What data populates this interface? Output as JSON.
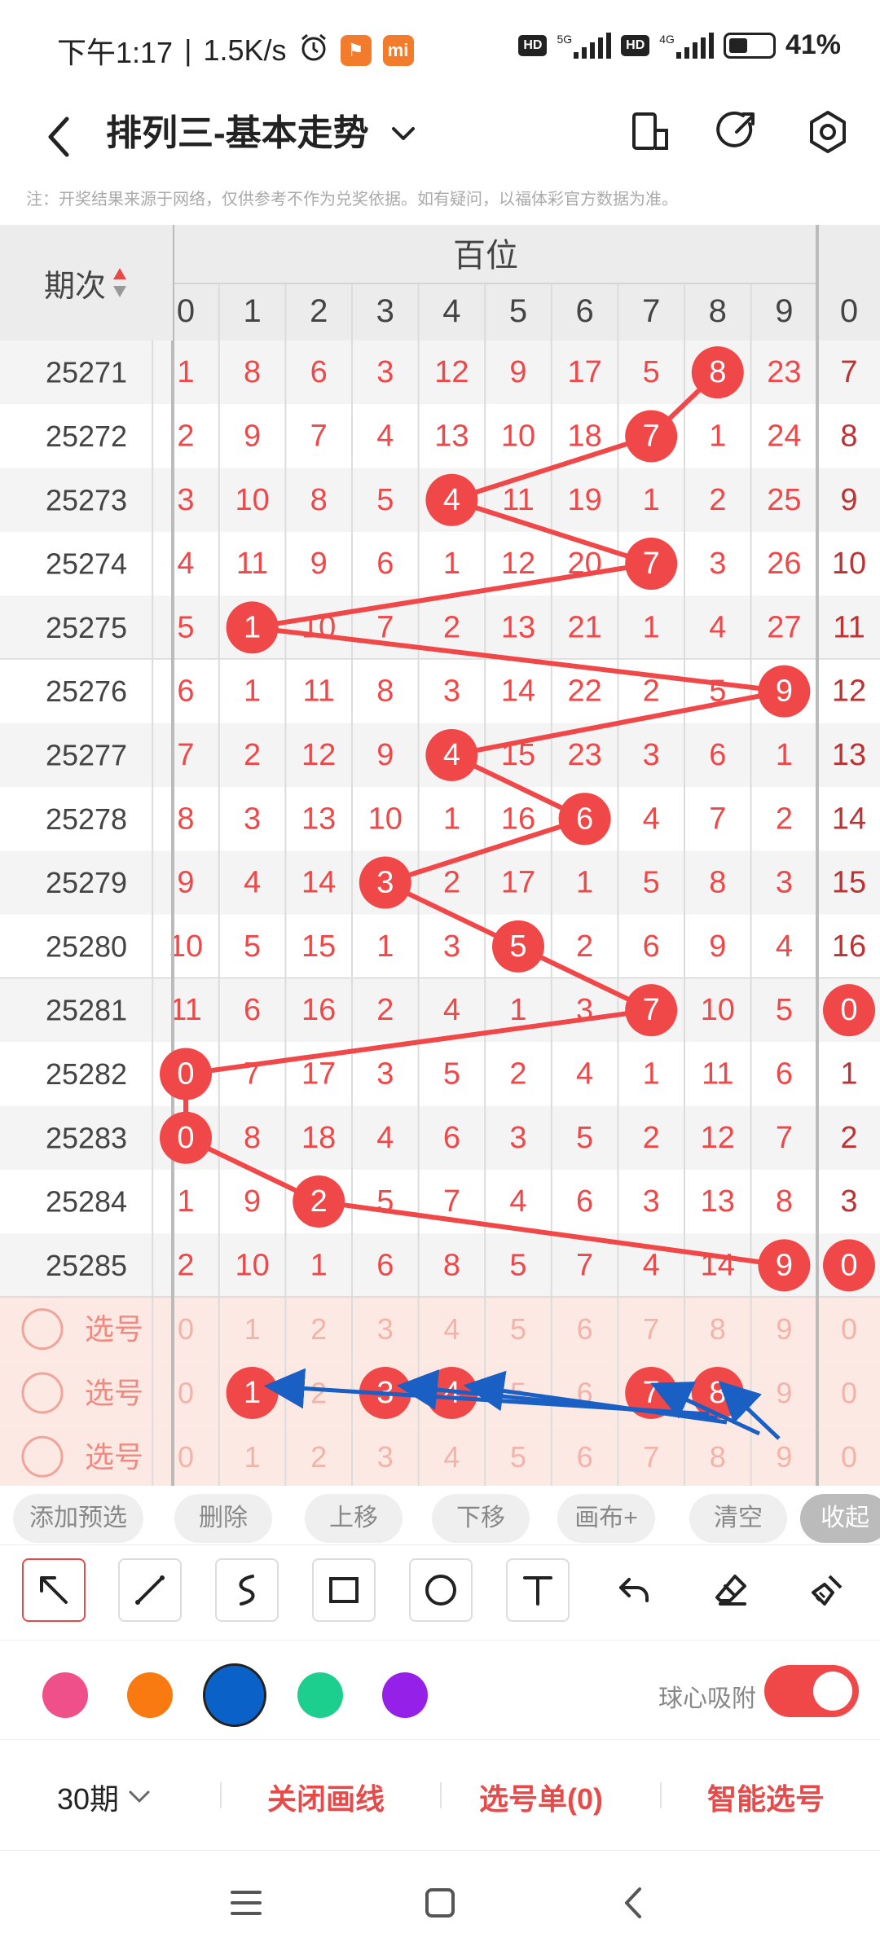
{
  "status_bar": {
    "time": "下午1:17",
    "speed": "1.5K/s",
    "app_badge": "mi",
    "hd": "HD",
    "net_5g": "5G",
    "net_4g": "4G",
    "battery": "41%"
  },
  "header": {
    "title": "排列三-基本走势"
  },
  "note": "注：开奖结果来源于网络，仅供参考不作为兑奖依据。如有疑问，以福体彩官方数据为准。",
  "table": {
    "period_header": "期次",
    "group_label": "百位",
    "columns": [
      "0",
      "1",
      "2",
      "3",
      "4",
      "5",
      "6",
      "7",
      "8",
      "9"
    ],
    "next_col": "0",
    "rows": [
      {
        "period": "25271",
        "cells": [
          "1",
          "8",
          "6",
          "3",
          "12",
          "9",
          "17",
          "5",
          "8",
          "23"
        ],
        "hit": 8,
        "next": "7"
      },
      {
        "period": "25272",
        "cells": [
          "2",
          "9",
          "7",
          "4",
          "13",
          "10",
          "18",
          "7",
          "1",
          "24"
        ],
        "hit": 7,
        "next": "8"
      },
      {
        "period": "25273",
        "cells": [
          "3",
          "10",
          "8",
          "5",
          "4",
          "11",
          "19",
          "1",
          "2",
          "25"
        ],
        "hit": 4,
        "next": "9"
      },
      {
        "period": "25274",
        "cells": [
          "4",
          "11",
          "9",
          "6",
          "1",
          "12",
          "20",
          "7",
          "3",
          "26"
        ],
        "hit": 7,
        "next": "10"
      },
      {
        "period": "25275",
        "cells": [
          "5",
          "1",
          "10",
          "7",
          "2",
          "13",
          "21",
          "1",
          "4",
          "27"
        ],
        "hit": 1,
        "next": "11"
      },
      {
        "period": "25276",
        "cells": [
          "6",
          "1",
          "11",
          "8",
          "3",
          "14",
          "22",
          "2",
          "5",
          "9"
        ],
        "hit": 9,
        "next": "12"
      },
      {
        "period": "25277",
        "cells": [
          "7",
          "2",
          "12",
          "9",
          "4",
          "15",
          "23",
          "3",
          "6",
          "1"
        ],
        "hit": 4,
        "next": "13"
      },
      {
        "period": "25278",
        "cells": [
          "8",
          "3",
          "13",
          "10",
          "1",
          "16",
          "6",
          "4",
          "7",
          "2"
        ],
        "hit": 6,
        "next": "14"
      },
      {
        "period": "25279",
        "cells": [
          "9",
          "4",
          "14",
          "3",
          "2",
          "17",
          "1",
          "5",
          "8",
          "3"
        ],
        "hit": 3,
        "next": "15"
      },
      {
        "period": "25280",
        "cells": [
          "10",
          "5",
          "15",
          "1",
          "3",
          "5",
          "2",
          "6",
          "9",
          "4"
        ],
        "hit": 5,
        "next": "16"
      },
      {
        "period": "25281",
        "cells": [
          "11",
          "6",
          "16",
          "2",
          "4",
          "1",
          "3",
          "7",
          "10",
          "5"
        ],
        "hit": 7,
        "next": "0"
      },
      {
        "period": "25282",
        "cells": [
          "0",
          "7",
          "17",
          "3",
          "5",
          "2",
          "4",
          "1",
          "11",
          "6"
        ],
        "hit": 0,
        "next": "1"
      },
      {
        "period": "25283",
        "cells": [
          "0",
          "8",
          "18",
          "4",
          "6",
          "3",
          "5",
          "2",
          "12",
          "7"
        ],
        "hit": 0,
        "next": "2"
      },
      {
        "period": "25284",
        "cells": [
          "1",
          "9",
          "2",
          "5",
          "7",
          "4",
          "6",
          "3",
          "13",
          "8"
        ],
        "hit": 2,
        "next": "3"
      },
      {
        "period": "25285",
        "cells": [
          "2",
          "10",
          "1",
          "6",
          "8",
          "5",
          "7",
          "4",
          "14",
          "9"
        ],
        "hit": 9,
        "next": "0"
      }
    ],
    "pick_rows": [
      {
        "label": "选号",
        "selected": []
      },
      {
        "label": "选号",
        "selected": [
          1,
          3,
          4,
          7,
          8
        ]
      },
      {
        "label": "选号",
        "selected": []
      }
    ]
  },
  "actions": [
    "添加预选",
    "删除",
    "上移",
    "下移",
    "画布+",
    "清空",
    "收起"
  ],
  "tools": [
    "arrow-select",
    "line",
    "curve",
    "rectangle",
    "circle",
    "text",
    "undo",
    "eraser",
    "clear-brush"
  ],
  "palette": {
    "colors": [
      "#f0508a",
      "#f97a10",
      "#0a62c8",
      "#1ccf8e",
      "#9520e8"
    ],
    "selected": 2,
    "red": "#f04848",
    "blue": "#1a5fc4"
  },
  "snap": {
    "label": "球心吸附",
    "enabled": true
  },
  "bottom": {
    "period_select": "30期",
    "close_lines": "关闭画线",
    "pick_list": "选号单(0)",
    "smart_pick": "智能选号"
  }
}
